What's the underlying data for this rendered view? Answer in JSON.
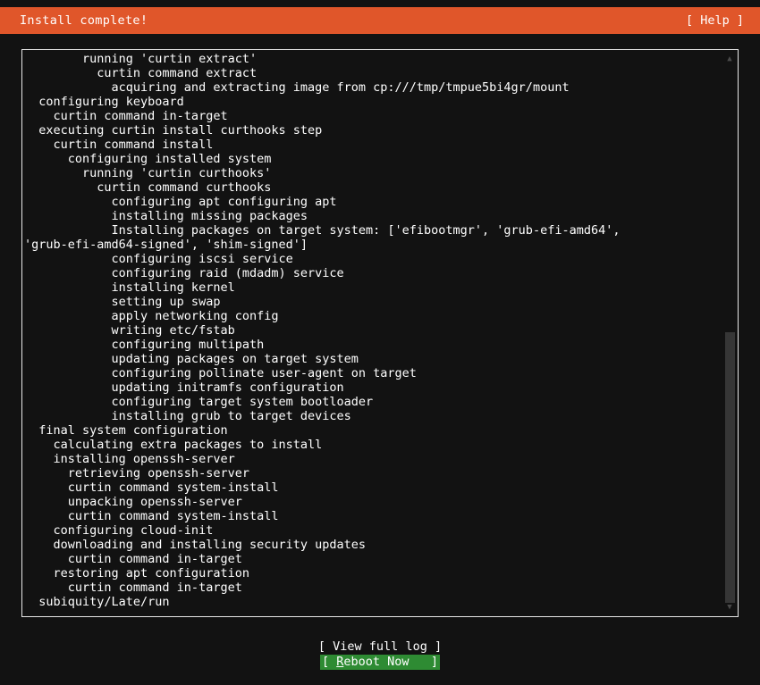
{
  "header": {
    "title": "Install complete!",
    "help_label": "[ Help ]",
    "background_color": "#e0562a",
    "text_color": "#ffffff"
  },
  "log": {
    "lines": [
      "        running 'curtin extract'",
      "          curtin command extract",
      "            acquiring and extracting image from cp:///tmp/tmpue5bi4gr/mount",
      "  configuring keyboard",
      "    curtin command in-target",
      "  executing curtin install curthooks step",
      "    curtin command install",
      "      configuring installed system",
      "        running 'curtin curthooks'",
      "          curtin command curthooks",
      "            configuring apt configuring apt",
      "            installing missing packages",
      "            Installing packages on target system: ['efibootmgr', 'grub-efi-amd64',",
      "'grub-efi-amd64-signed', 'shim-signed']",
      "            configuring iscsi service",
      "            configuring raid (mdadm) service",
      "            installing kernel",
      "            setting up swap",
      "            apply networking config",
      "            writing etc/fstab",
      "            configuring multipath",
      "            updating packages on target system",
      "            configuring pollinate user-agent on target",
      "            updating initramfs configuration",
      "            configuring target system bootloader",
      "            installing grub to target devices",
      "  final system configuration",
      "    calculating extra packages to install",
      "    installing openssh-server",
      "      retrieving openssh-server",
      "      curtin command system-install",
      "      unpacking openssh-server",
      "      curtin command system-install",
      "    configuring cloud-init",
      "    downloading and installing security updates",
      "      curtin command in-target",
      "    restoring apt configuration",
      "      curtin command in-target",
      "  subiquity/Late/run"
    ]
  },
  "scrollbar": {
    "up_arrow": "▲",
    "down_arrow": "▼",
    "thumb_color": "#363636"
  },
  "footer": {
    "view_log_label": "[ View full log ]",
    "reboot_prefix": "[ ",
    "reboot_accel": "R",
    "reboot_rest": "eboot Now",
    "reboot_suffix": "   ]",
    "selected_color": "#2e8b33"
  }
}
